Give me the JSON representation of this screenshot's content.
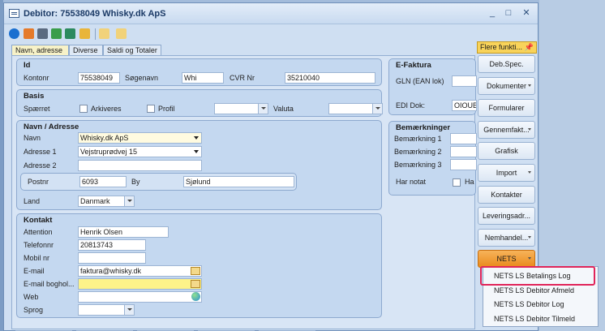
{
  "window": {
    "title": "Debitor: 75538049 Whisky.dk ApS",
    "minimize": "_",
    "maximize": "□",
    "close": "✕"
  },
  "tabs": [
    "Navn, adresse",
    "Diverse",
    "Saldi og Totaler"
  ],
  "id_group": {
    "title": "Id",
    "kontonr_label": "Kontonr",
    "kontonr": "75538049",
    "soegenavn_label": "Søgenavn",
    "soegenavn": "Whi",
    "cvr_label": "CVR Nr",
    "cvr": "35210040"
  },
  "basis_group": {
    "title": "Basis",
    "spaerret_label": "Spærret",
    "arkiveres_label": "Arkiveres",
    "profil_label": "Profil",
    "profil": "",
    "valuta_label": "Valuta",
    "valuta": ""
  },
  "adresse_group": {
    "title": "Navn / Adresse",
    "navn_label": "Navn",
    "navn": "Whisky.dk ApS",
    "adresse1_label": "Adresse 1",
    "adresse1": "Vejstruprødvej 15",
    "adresse2_label": "Adresse 2",
    "adresse2": "",
    "postnr_label": "Postnr",
    "postnr": "6093",
    "by_label": "By",
    "by": "Sjølund",
    "land_label": "Land",
    "land": "Danmark"
  },
  "kontakt_group": {
    "title": "Kontakt",
    "attention_label": "Attention",
    "attention": "Henrik Olsen",
    "telefon_label": "Telefonnr",
    "telefon": "20813743",
    "mobil_label": "Mobil nr",
    "mobil": "",
    "email_label": "E-mail",
    "email": "faktura@whisky.dk",
    "email_bogholderi_label": "E-mail boghol...",
    "email_bogholderi": "",
    "web_label": "Web",
    "web": "",
    "sprog_label": "Sprog",
    "sprog": ""
  },
  "efaktura_group": {
    "title": "E-Faktura",
    "gln_label": "GLN (EAN lok)",
    "gln": "",
    "edi_label": "EDI Dok:",
    "edi": "OIOUB"
  },
  "bemaerkninger_group": {
    "title": "Bemærkninger",
    "b1_label": "Bemærkning 1",
    "b2_label": "Bemærkning 2",
    "b3_label": "Bemærkning 3",
    "har_notat_label": "Har notat",
    "har_notat_partial": "Ha"
  },
  "right_panel": {
    "header": "Flere funkti...",
    "pin": "📌",
    "buttons": [
      "Deb.Spec.",
      "Dokumenter",
      "Formularer",
      "Gennemfakt...",
      "Grafisk",
      "Import",
      "Kontakter",
      "Leveringsadr...",
      "Nemhandel...",
      "NETS"
    ]
  },
  "nets_menu": {
    "items": [
      "NETS LS Betalings Log",
      "NETS LS Debitor Afmeld",
      "NETS LS Debitor Log",
      "NETS LS Debitor Tilmeld"
    ]
  },
  "colors": {
    "accent_orange": "#e98a1c",
    "highlight_red": "#e0245a",
    "field_yellow": "#fdf38a"
  }
}
